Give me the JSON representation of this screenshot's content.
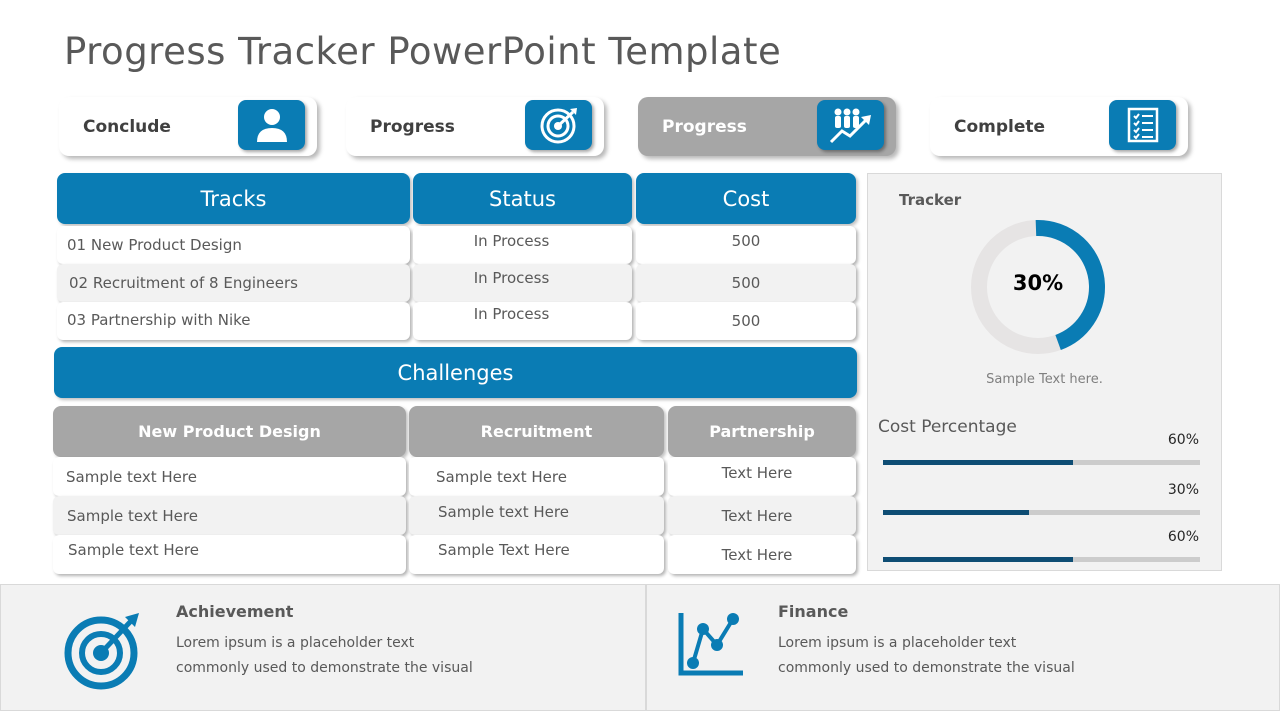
{
  "title": "Progress Tracker PowerPoint Template",
  "stages": [
    {
      "label": "Conclude",
      "icon": "person-icon",
      "active": false
    },
    {
      "label": "Progress",
      "icon": "target-icon",
      "active": false
    },
    {
      "label": "Progress",
      "icon": "team-growth-icon",
      "active": true
    },
    {
      "label": "Complete",
      "icon": "checklist-icon",
      "active": false
    }
  ],
  "tracks_table": {
    "headers": [
      "Tracks",
      "Status",
      "Cost"
    ],
    "rows": [
      {
        "track": "01  New Product Design",
        "status": "In Process",
        "cost": "500"
      },
      {
        "track": "02  Recruitment of 8 Engineers",
        "status": "In Process",
        "cost": "500"
      },
      {
        "track": "03  Partnership with Nike",
        "status": "In Process",
        "cost": "500"
      }
    ]
  },
  "challenges": {
    "title": "Challenges",
    "headers": [
      "New Product Design",
      "Recruitment",
      "Partnership"
    ],
    "rows": [
      [
        "Sample text Here",
        "Sample text Here",
        "Text Here"
      ],
      [
        "Sample text Here",
        "Sample text Here",
        "Text Here"
      ],
      [
        "Sample text Here",
        "Sample Text Here",
        "Text Here"
      ]
    ]
  },
  "tracker": {
    "title": "Tracker",
    "percent_label": "30%",
    "ring_fill_fraction": 0.45,
    "caption": "Sample Text here.",
    "cost_title": "Cost Percentage",
    "bars": [
      {
        "label": "60%",
        "fill_fraction": 0.6
      },
      {
        "label": "30%",
        "fill_fraction": 0.46
      },
      {
        "label": "60%",
        "fill_fraction": 0.6
      }
    ]
  },
  "footer": [
    {
      "title": "Achievement",
      "line1": "Lorem ipsum is a placeholder text",
      "line2": "commonly used to demonstrate  the visual",
      "icon": "target-arrow-icon"
    },
    {
      "title": "Finance",
      "line1": "Lorem ipsum is a placeholder text",
      "line2": "commonly used to demonstrate  the visual",
      "icon": "line-chart-icon"
    }
  ],
  "colors": {
    "accent": "#0a7cb4",
    "bar_fill": "#0e4d74",
    "bar_track": "#cccccc",
    "gray_header": "#a6a6a6",
    "panel_bg": "#f2f2f2"
  }
}
